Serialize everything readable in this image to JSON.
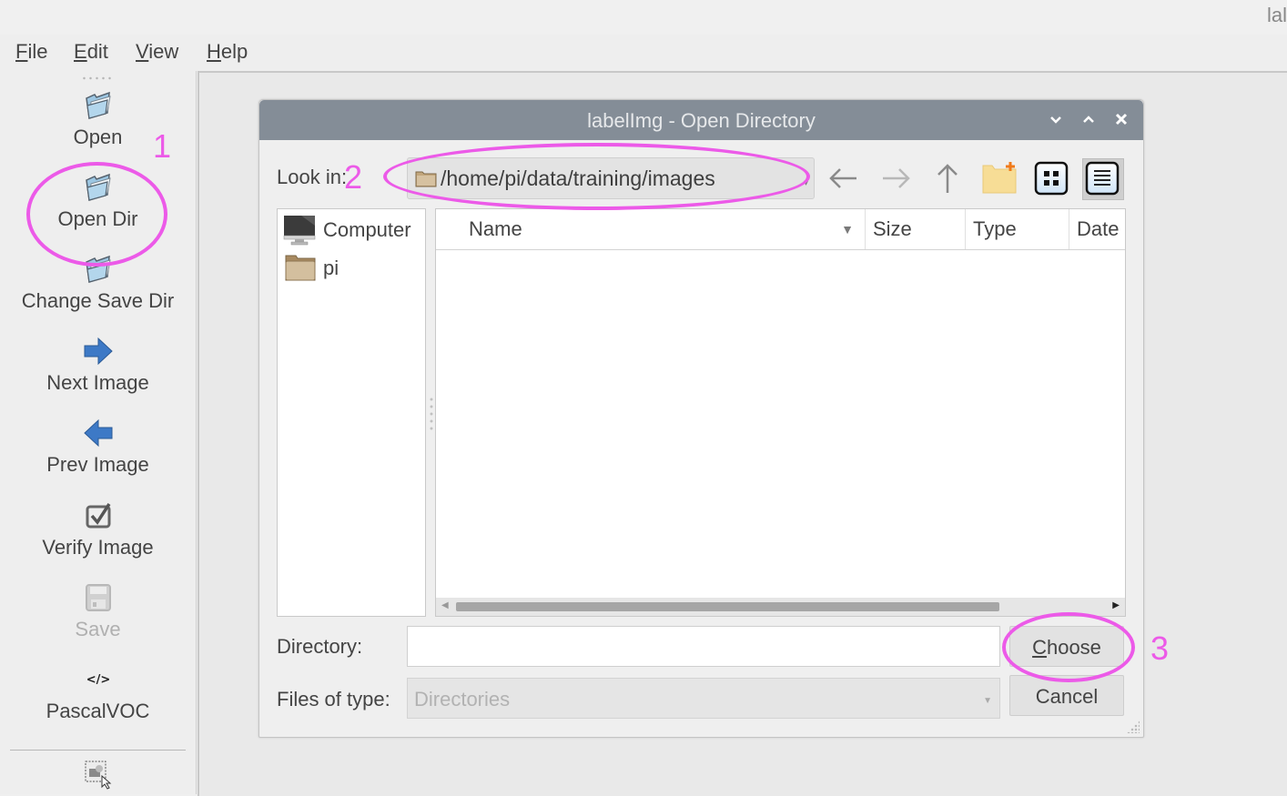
{
  "app": {
    "title_fragment": "lal"
  },
  "menubar": [
    {
      "label": "File",
      "mnemonic": "F",
      "rest": "ile"
    },
    {
      "label": "Edit",
      "mnemonic": "E",
      "rest": "dit"
    },
    {
      "label": "View",
      "mnemonic": "V",
      "rest": "iew"
    },
    {
      "label": "Help",
      "mnemonic": "H",
      "rest": "elp"
    }
  ],
  "toolbar": {
    "items": [
      {
        "label": "Open",
        "icon": "open-folder-icon",
        "enabled": true
      },
      {
        "label": "Open Dir",
        "icon": "open-folder-icon",
        "enabled": true
      },
      {
        "label": "Change Save Dir",
        "icon": "open-folder-icon",
        "enabled": true
      },
      {
        "label": "Next Image",
        "icon": "arrow-right-icon",
        "enabled": true
      },
      {
        "label": "Prev Image",
        "icon": "arrow-left-icon",
        "enabled": true
      },
      {
        "label": "Verify Image",
        "icon": "checkbox-icon",
        "enabled": true
      },
      {
        "label": "Save",
        "icon": "floppy-disk-icon",
        "enabled": false
      },
      {
        "label": "PascalVOC",
        "icon": "code-icon",
        "enabled": true
      }
    ],
    "extra_icon": "create-rectbox-icon"
  },
  "dialog": {
    "title": "labelImg - Open Directory",
    "window_buttons": [
      "minimize",
      "maximize",
      "close"
    ],
    "look_in_label": "Look in:",
    "look_in_path": "/home/pi/data/training/images",
    "nav_buttons": [
      "back",
      "forward",
      "parent-directory",
      "new-folder",
      "icon-view",
      "detail-view"
    ],
    "active_view": "detail-view",
    "places": [
      {
        "label": "Computer",
        "icon": "computer-icon"
      },
      {
        "label": "pi",
        "icon": "folder-icon"
      }
    ],
    "columns": [
      "Name",
      "Size",
      "Type",
      "Date"
    ],
    "sort_column": "Name",
    "rows": [],
    "directory_label": "Directory:",
    "directory_value": "",
    "files_of_type_label": "Files of type:",
    "files_of_type_value": "Directories",
    "choose_button": {
      "label": "Choose",
      "mnemonic": "C",
      "rest": "hoose"
    },
    "cancel_button": "Cancel"
  },
  "annotations": {
    "color": "#ec5ae8",
    "steps": [
      "1",
      "2",
      "3"
    ]
  }
}
